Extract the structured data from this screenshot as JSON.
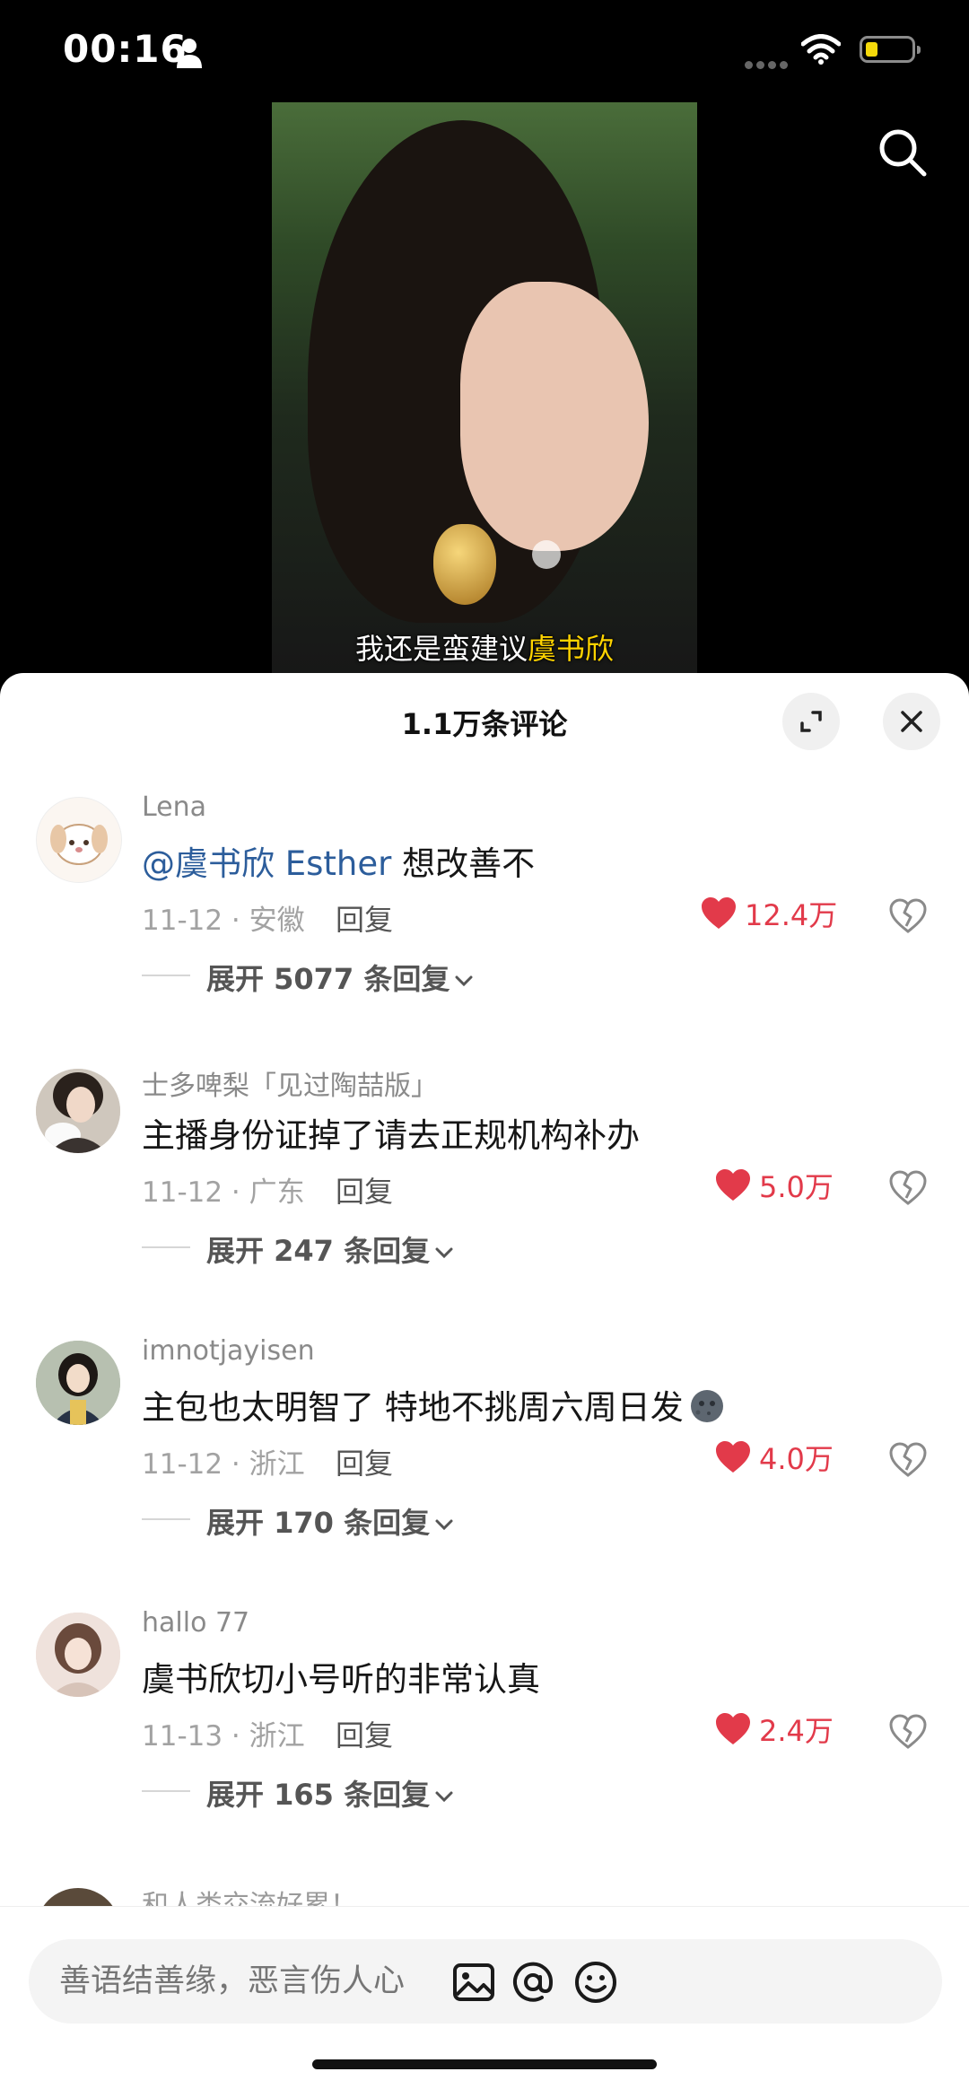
{
  "status_bar": {
    "time": "00:16"
  },
  "video": {
    "subtitle_prefix": "我还是蛮建议",
    "subtitle_highlight": "虞书欣"
  },
  "sheet": {
    "title": "1.1万条评论"
  },
  "comments": [
    {
      "user": "Lena",
      "mention": "@虞书欣 Esther",
      "text": " 想改善不",
      "meta": "11-12 · 安徽",
      "reply": "回复",
      "likes": "12.4万",
      "expand": "展开 5077 条回复"
    },
    {
      "user": "士多啤梨「见过陶喆版」",
      "text": "主播身份证掉了请去正规机构补办",
      "meta": "11-12 · 广东",
      "reply": "回复",
      "likes": "5.0万",
      "expand": "展开 247 条回复"
    },
    {
      "user": "imnotjayisen",
      "text": "主包也太明智了 特地不挑周六周日发",
      "meta": "11-12 · 浙江",
      "reply": "回复",
      "likes": "4.0万",
      "expand": "展开 170 条回复"
    },
    {
      "user": "hallo 77",
      "text": "虞书欣切小号听的非常认真",
      "meta": "11-13 · 浙江",
      "reply": "回复",
      "likes": "2.4万",
      "expand": "展开 165 条回复"
    }
  ],
  "next_comment_user": "和人类交流好累！",
  "input": {
    "placeholder": "善语结善缘，恶言伤人心"
  },
  "colors": {
    "like": "#e23a4a",
    "mention": "#2c5d9b",
    "battery": "#f5d90a"
  },
  "icons": [
    "person-icon",
    "wifi-icon",
    "battery-icon",
    "search-icon",
    "expand-icon",
    "close-icon",
    "heart-icon",
    "dislike-icon",
    "chevron-down-icon",
    "image-icon",
    "at-icon",
    "emoji-icon"
  ]
}
